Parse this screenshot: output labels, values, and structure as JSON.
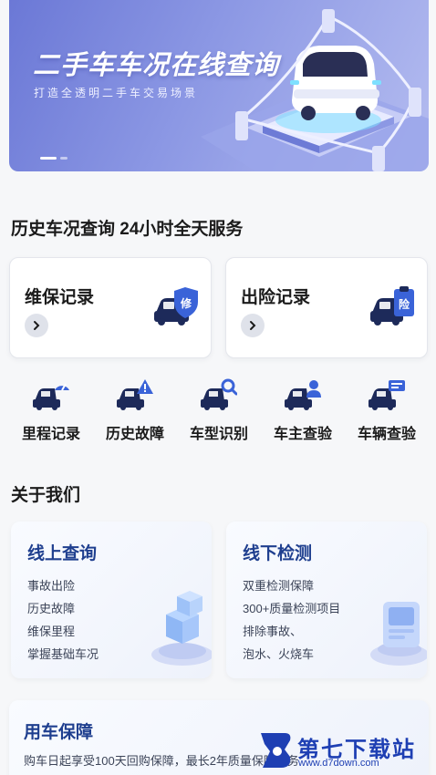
{
  "banner": {
    "title": "二手车车况在线查询",
    "subtitle": "打造全透明二手车交易场景",
    "page_count": 2,
    "active_page": 1
  },
  "section1": {
    "title": "历史车况查询 24小时全天服务"
  },
  "records": [
    {
      "label": "维保记录",
      "badge": "修",
      "icon": "car-shield-icon"
    },
    {
      "label": "出险记录",
      "badge": "险",
      "icon": "car-clipboard-icon"
    }
  ],
  "services": [
    {
      "label": "里程记录",
      "icon": "car-speedometer-icon"
    },
    {
      "label": "历史故障",
      "icon": "car-warning-icon"
    },
    {
      "label": "车型识别",
      "icon": "car-search-icon"
    },
    {
      "label": "车主查验",
      "icon": "car-person-icon"
    },
    {
      "label": "车辆查验",
      "icon": "car-card-icon"
    }
  ],
  "about": {
    "title": "关于我们",
    "cards": [
      {
        "title": "线上查询",
        "items": [
          "事故出险",
          "历史故障",
          "维保里程",
          "掌握基础车况"
        ]
      },
      {
        "title": "线下检测",
        "items": [
          "双重检测保障",
          "300+质量检测项目",
          "排除事故、",
          "泡水、火烧车"
        ]
      }
    ],
    "bottom": {
      "title": "用车保障",
      "desc": "购车日起享受100天回购保障，最长2年质量保障服务"
    }
  },
  "watermark": {
    "title": "第七下载站",
    "url": "www.d7down.com"
  },
  "colors": {
    "accent": "#1f3f8f",
    "icon_dark": "#1d2a5a",
    "brand_blue": "#1e3fb3",
    "banner": "#7f8be0"
  }
}
